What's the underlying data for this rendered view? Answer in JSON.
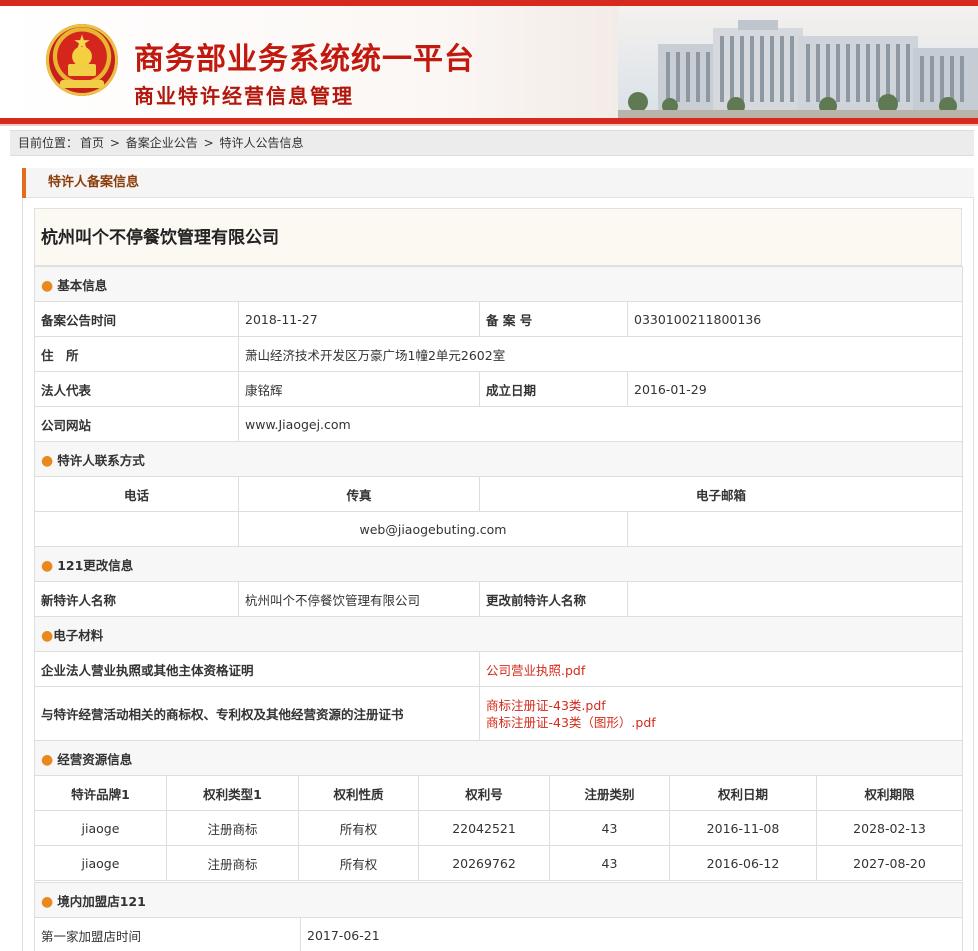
{
  "header": {
    "title": "商务部业务系统统一平台",
    "subtitle": "商业特许经营信息管理"
  },
  "breadcrumb": {
    "prefix": "目前位置：",
    "items": [
      "首页",
      "备案企业公告",
      "特许人公告信息"
    ],
    "separator": ">"
  },
  "section_title": "特许人备案信息",
  "company_name": "杭州叫个不停餐饮管理有限公司",
  "basic": {
    "heading": "基本信息",
    "date_label": "备案公告时间",
    "date_value": "2018-11-27",
    "no_label": "备 案 号",
    "no_value": "0330100211800136",
    "addr_label": "住　所",
    "addr_value": "萧山经济技术开发区万豪广场1幢2单元2602室",
    "rep_label": "法人代表",
    "rep_value": "康铭辉",
    "est_label": "成立日期",
    "est_value": "2016-01-29",
    "web_label": "公司网站",
    "web_value": "www.Jiaogej.com"
  },
  "contact": {
    "heading": "特许人联系方式",
    "phone_label": "电话",
    "fax_label": "传真",
    "email_label": "电子邮箱",
    "email_value": "web@jiaogebuting.com"
  },
  "change": {
    "heading": "121更改信息",
    "new_label": "新特许人名称",
    "new_value": "杭州叫个不停餐饮管理有限公司",
    "old_label": "更改前特许人名称"
  },
  "materials": {
    "heading": "电子材料",
    "license_label": "企业法人营业执照或其他主体资格证明",
    "license_file": "公司营业执照.pdf",
    "tm_label": "与特许经营活动相关的商标权、专利权及其他经营资源的注册证书",
    "tm_file1": "商标注册证-43类.pdf",
    "tm_file2": "商标注册证-43类（图形）.pdf"
  },
  "resources": {
    "heading": "经营资源信息",
    "columns": [
      "特许品牌1",
      "权利类型1",
      "权利性质",
      "权利号",
      "注册类别",
      "权利日期",
      "权利期限"
    ],
    "rows": [
      [
        "jiaoge",
        "注册商标",
        "所有权",
        "22042521",
        "43",
        "2016-11-08",
        "2028-02-13"
      ],
      [
        "jiaoge",
        "注册商标",
        "所有权",
        "20269762",
        "43",
        "2016-06-12",
        "2027-08-20"
      ]
    ]
  },
  "stores": {
    "heading": "境内加盟店121",
    "first_label": "第一家加盟店时间",
    "first_value": "2017-06-21"
  },
  "colors": {
    "brand_red": "#d62a1f",
    "accent_orange": "#e36c1d",
    "link_red": "#d42a1a"
  }
}
